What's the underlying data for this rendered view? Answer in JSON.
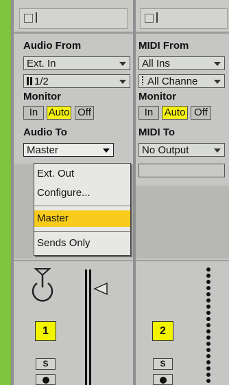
{
  "tracks": [
    {
      "input_from_label": "Audio From",
      "input_type": "Ext. In",
      "input_channel": "1/2",
      "monitor_label": "Monitor",
      "monitor_options": [
        "In",
        "Auto",
        "Off"
      ],
      "monitor_selected": "Auto",
      "output_label": "Audio To",
      "output_value": "Master",
      "number": "1",
      "solo_label": "S"
    },
    {
      "input_from_label": "MIDI From",
      "input_type": "All Ins",
      "input_channel": "All Channe",
      "monitor_label": "Monitor",
      "monitor_options": [
        "In",
        "Auto",
        "Off"
      ],
      "monitor_selected": "Auto",
      "output_label": "MIDI To",
      "output_value": "No Output",
      "number": "2",
      "solo_label": "S"
    }
  ],
  "output_menu": {
    "items": [
      "Ext. Out",
      "Configure...",
      "Master",
      "Sends Only"
    ],
    "selected": "Master"
  },
  "colors": {
    "background": "#7ec43c",
    "track_number": "#f3f500",
    "auto_active": "#f6f312",
    "menu_selected": "#f7cc1d"
  },
  "icons": [
    "volume-knob-icon",
    "meter-arrow-icon",
    "record-icon",
    "chevron-down-icon"
  ]
}
